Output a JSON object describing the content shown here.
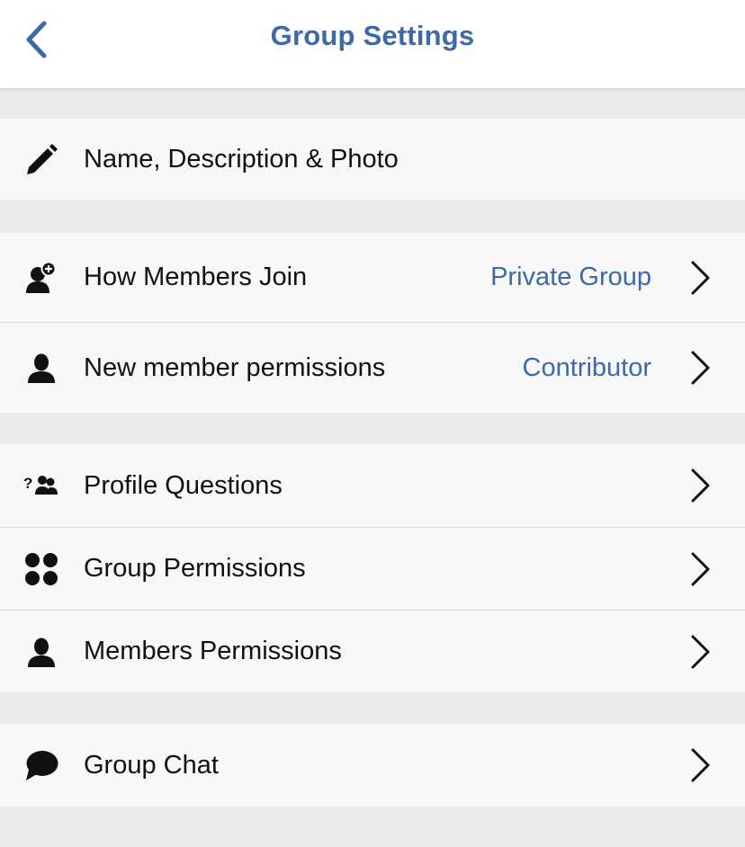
{
  "header": {
    "title": "Group Settings",
    "back_icon": "chevron-left-icon"
  },
  "sections": [
    {
      "rows": [
        {
          "icon": "pencil-icon",
          "label": "Name, Description & Photo",
          "value": "",
          "has_chevron": false
        }
      ]
    },
    {
      "rows": [
        {
          "icon": "user-add-icon",
          "label": "How Members Join",
          "value": "Private Group",
          "has_chevron": true
        },
        {
          "icon": "user-icon",
          "label": "New member permissions",
          "value": "Contributor",
          "has_chevron": true
        }
      ]
    },
    {
      "rows": [
        {
          "icon": "group-question-icon",
          "label": "Profile Questions",
          "value": "",
          "has_chevron": true
        },
        {
          "icon": "four-dots-icon",
          "label": "Group Permissions",
          "value": "",
          "has_chevron": true
        },
        {
          "icon": "user-icon",
          "label": "Members Permissions",
          "value": "",
          "has_chevron": true
        }
      ]
    },
    {
      "rows": [
        {
          "icon": "chat-bubble-icon",
          "label": "Group Chat",
          "value": "",
          "has_chevron": true
        }
      ]
    }
  ],
  "colors": {
    "accent": "#3d69a8",
    "background": "#ebebeb",
    "row_background": "#f8f8f8",
    "text": "#111111"
  }
}
